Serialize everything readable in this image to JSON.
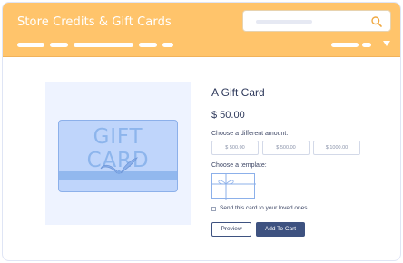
{
  "header": {
    "title": "Store Credits & Gift Cards",
    "bg_color": "#ffc46b",
    "search_icon": "search-icon",
    "menu_icon": "chevron-down-icon"
  },
  "product": {
    "image_text": "GIFT CARD",
    "name": "A Gift Card",
    "price": "$ 50.00",
    "amount_label": "Choose a different amount:",
    "amounts": [
      "$ 500.00",
      "$ 500.00",
      "$ 1000.00"
    ],
    "template_label": "Choose a template:",
    "send_label": "Send this card to your loved ones.",
    "preview_label": "Preview",
    "cart_label": "Add To Cart",
    "accent_color": "#3e5280"
  }
}
